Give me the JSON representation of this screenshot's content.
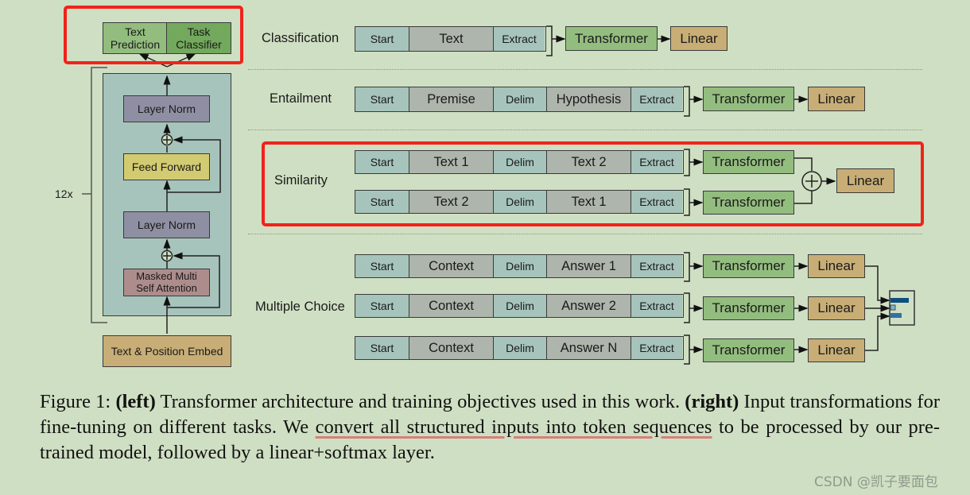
{
  "left": {
    "heads": {
      "text_prediction": "Text\nPrediction",
      "task_classifier": "Task\nClassifier"
    },
    "repeat_label": "12x",
    "blocks": {
      "layer_norm_top": "Layer Norm",
      "feed_forward": "Feed Forward",
      "layer_norm_bottom": "Layer Norm",
      "masked_attention": "Masked Multi\nSelf Attention",
      "embed": "Text & Position Embed"
    }
  },
  "tasks": {
    "classification": {
      "label": "Classification",
      "seq": [
        "Start",
        "Text",
        "Extract"
      ],
      "transformer": "Transformer",
      "linear": "Linear"
    },
    "entailment": {
      "label": "Entailment",
      "seq": [
        "Start",
        "Premise",
        "Delim",
        "Hypothesis",
        "Extract"
      ],
      "transformer": "Transformer",
      "linear": "Linear"
    },
    "similarity": {
      "label": "Similarity",
      "seq1": [
        "Start",
        "Text 1",
        "Delim",
        "Text 2",
        "Extract"
      ],
      "seq2": [
        "Start",
        "Text 2",
        "Delim",
        "Text 1",
        "Extract"
      ],
      "transformer": "Transformer",
      "plus": "+",
      "linear": "Linear"
    },
    "multiple_choice": {
      "label": "Multiple Choice",
      "seq1": [
        "Start",
        "Context",
        "Delim",
        "Answer 1",
        "Extract"
      ],
      "seq2": [
        "Start",
        "Context",
        "Delim",
        "Answer 2",
        "Extract"
      ],
      "seq3": [
        "Start",
        "Context",
        "Delim",
        "Answer N",
        "Extract"
      ],
      "transformer": "Transformer",
      "linear": "Linear"
    }
  },
  "caption": {
    "fig": "Figure 1:",
    "left_b": "(left)",
    "t1": " Transformer architecture and training objectives used in this work. ",
    "right_b": "(right)",
    "t2": " Input transformations for fine-tuning on different tasks.  We ",
    "u1": "convert all structured inputs into token sequences",
    "t3": " to be processed by our pre-trained model, followed by a linear+softmax layer."
  },
  "watermark": "CSDN @凯子要面包",
  "colors": {
    "highlight": "#f0231b",
    "teal": "#a6c4bb",
    "grey": "#aeb5ac",
    "transformer": "#93bd7f",
    "linear": "#c8ae76"
  }
}
